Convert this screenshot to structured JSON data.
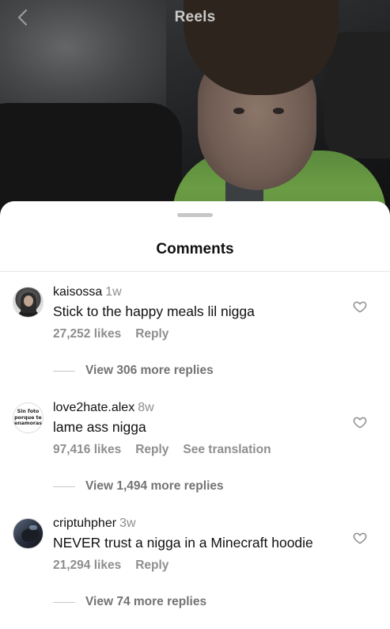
{
  "header": {
    "title": "Reels",
    "back_icon": "chevron-left-icon"
  },
  "sheet": {
    "title": "Comments"
  },
  "comments": [
    {
      "username": "kaisossa",
      "time": "1w",
      "text": "Stick to the happy meals lil nigga",
      "likes": "27,252 likes",
      "reply": "Reply",
      "translation": "",
      "more_replies": "View 306 more replies",
      "avatar_icon": "profile-photo"
    },
    {
      "username": "love2hate.alex",
      "time": "8w",
      "text": "lame ass nigga",
      "likes": "97,416 likes",
      "reply": "Reply",
      "translation": "See translation",
      "more_replies": "View 1,494 more replies",
      "avatar_icon": "text-avatar",
      "avatar_text": "Sin foto porque te enamoras"
    },
    {
      "username": "criptuhpher",
      "time": "3w",
      "text": "NEVER trust a nigga in a Minecraft hoodie",
      "likes": "21,294 likes",
      "reply": "Reply",
      "translation": "",
      "more_replies": "View 74 more replies",
      "avatar_icon": "profile-photo"
    }
  ],
  "colors": {
    "text": "#111111",
    "secondary": "#8e8e8e",
    "sheet_bg": "#ffffff"
  }
}
